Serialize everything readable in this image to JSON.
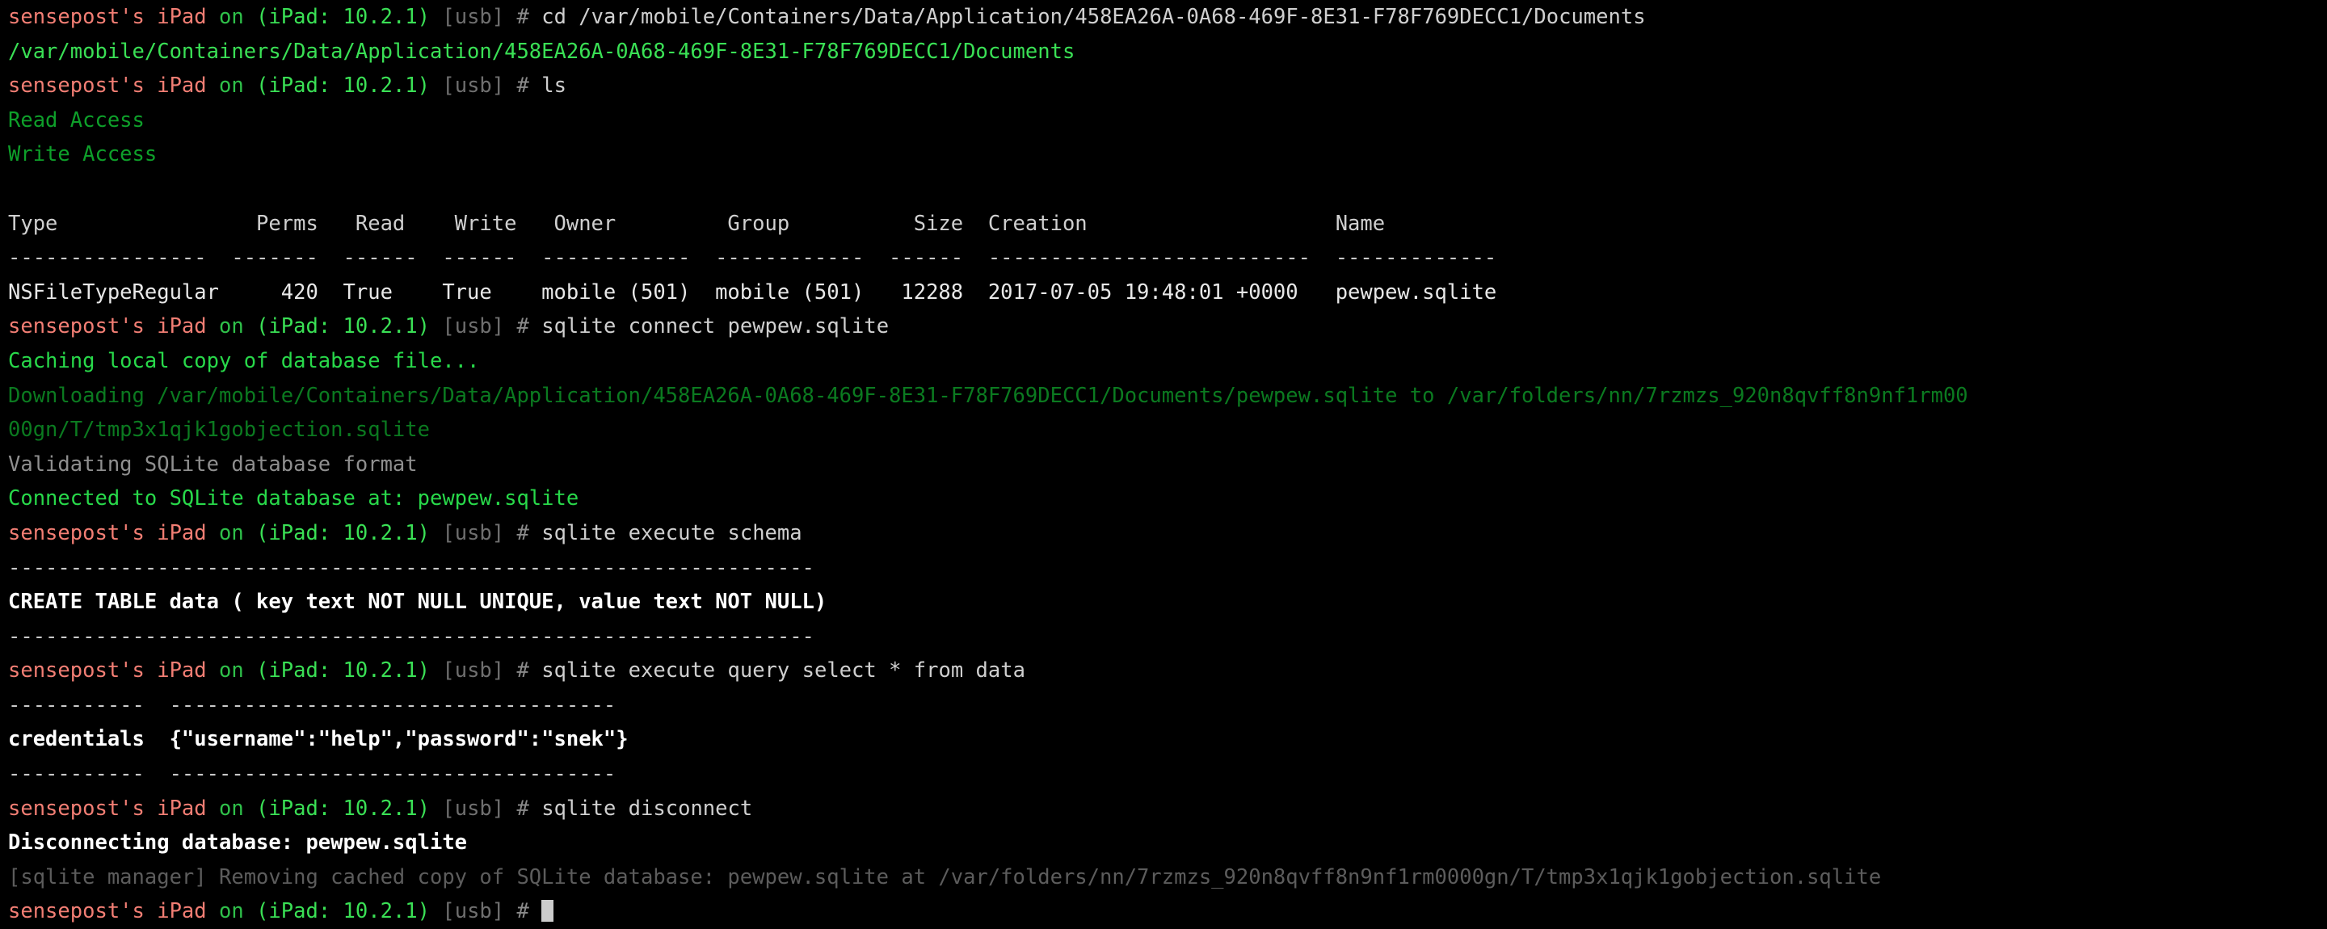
{
  "terminal": {
    "title": "objection iOS terminal session",
    "colors": {
      "background": "#000000",
      "host": "#f27e74",
      "device": "#3ae055",
      "transport": "#6f6f6f",
      "prompt_hash": "#8a8a8a",
      "command": "#cfcfcf",
      "success_green": "#28d94a",
      "dim_green": "#0b7a20",
      "grey_output": "#8f8f8f",
      "bold_white": "#ffffff",
      "cursor": "#cccccc"
    },
    "prompt": {
      "host": "sensepost's iPad",
      "on": "on",
      "device": "(iPad: 10.2.1)",
      "transport": "[usb]",
      "hash": "#"
    },
    "lines": [
      {
        "id": "cmd-cd",
        "type": "prompt",
        "command": "cd /var/mobile/Containers/Data/Application/458EA26A-0A68-469F-8E31-F78F769DECC1/Documents"
      },
      {
        "id": "out-cwd",
        "type": "output",
        "style": "path",
        "text": "/var/mobile/Containers/Data/Application/458EA26A-0A68-469F-8E31-F78F769DECC1/Documents"
      },
      {
        "id": "cmd-ls",
        "type": "prompt",
        "command": "ls"
      },
      {
        "id": "out-read-access",
        "type": "output",
        "style": "green",
        "text": "Read Access"
      },
      {
        "id": "out-write-access",
        "type": "output",
        "style": "green",
        "text": "Write Access"
      },
      {
        "id": "out-blank-1",
        "type": "output",
        "style": "grey",
        "text": ""
      },
      {
        "id": "table-header",
        "type": "table-header",
        "text": "Type                Perms   Read    Write   Owner         Group          Size  Creation                    Name"
      },
      {
        "id": "table-rule-top",
        "type": "dashes",
        "text": "----------------  -------  ------  ------  ------------  ------------  ------  --------------------------  -------------"
      },
      {
        "id": "table-row-1",
        "type": "table-row",
        "text": "NSFileTypeRegular     420  True    True    mobile (501)  mobile (501)   12288  2017-07-05 19:48:01 +0000   pewpew.sqlite"
      },
      {
        "id": "cmd-sqlite-connect",
        "type": "prompt",
        "command": "sqlite connect pewpew.sqlite"
      },
      {
        "id": "out-caching",
        "type": "output",
        "style": "green-bright",
        "text": "Caching local copy of database file..."
      },
      {
        "id": "out-downloading-1",
        "type": "output",
        "style": "green-dim",
        "text": "Downloading /var/mobile/Containers/Data/Application/458EA26A-0A68-469F-8E31-F78F769DECC1/Documents/pewpew.sqlite to /var/folders/nn/7rzmzs_920n8qvff8n9nf1rm00"
      },
      {
        "id": "out-downloading-2",
        "type": "output",
        "style": "green-dim",
        "text": "00gn/T/tmp3x1qjk1gobjection.sqlite"
      },
      {
        "id": "out-validating",
        "type": "output",
        "style": "grey",
        "text": "Validating SQLite database format"
      },
      {
        "id": "out-connected",
        "type": "output",
        "style": "green-bright",
        "text": "Connected to SQLite database at: pewpew.sqlite"
      },
      {
        "id": "cmd-sqlite-schema",
        "type": "prompt",
        "command": "sqlite execute schema"
      },
      {
        "id": "schema-rule-top",
        "type": "dashes",
        "text": "-----------------------------------------------------------------"
      },
      {
        "id": "schema-create-table",
        "type": "output",
        "style": "bold-white",
        "text": "CREATE TABLE data ( key text NOT NULL UNIQUE, value text NOT NULL)"
      },
      {
        "id": "schema-rule-bottom",
        "type": "dashes",
        "text": "-----------------------------------------------------------------"
      },
      {
        "id": "cmd-sqlite-query",
        "type": "prompt",
        "command": "sqlite execute query select * from data"
      },
      {
        "id": "query-rule-top",
        "type": "dashes",
        "text": "-----------  ------------------------------------"
      },
      {
        "id": "query-row-1",
        "type": "output",
        "style": "bold-white",
        "text": "credentials  {\"username\":\"help\",\"password\":\"snek\"}"
      },
      {
        "id": "query-rule-bottom",
        "type": "dashes",
        "text": "-----------  ------------------------------------"
      },
      {
        "id": "cmd-sqlite-disconnect",
        "type": "prompt",
        "command": "sqlite disconnect"
      },
      {
        "id": "out-disconnecting",
        "type": "output",
        "style": "bold-white",
        "text": "Disconnecting database: pewpew.sqlite"
      },
      {
        "id": "out-sqlite-manager",
        "type": "output",
        "style": "grey-dim",
        "text": "[sqlite manager] Removing cached copy of SQLite database: pewpew.sqlite at /var/folders/nn/7rzmzs_920n8qvff8n9nf1rm0000gn/T/tmp3x1qjk1gobjection.sqlite"
      },
      {
        "id": "cmd-final",
        "type": "prompt-cursor",
        "command": ""
      }
    ]
  }
}
